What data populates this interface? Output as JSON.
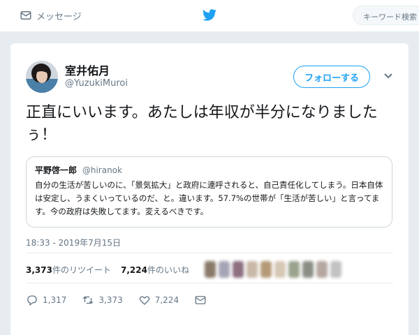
{
  "nav": {
    "messages_label": "メッセージ",
    "search_placeholder": "キーワード検索",
    "brand_color": "#1da1f2"
  },
  "tweet": {
    "author_name": "室井佑月",
    "author_handle": "@YuzukiMuroi",
    "follow_label": "フォローする",
    "text": "正直にいいます。あたしは年収が半分になりましたぅ！",
    "quoted": {
      "author_name": "平野啓一郎",
      "author_handle": "@hiranok",
      "text": "自分の生活が苦しいのに、「景気拡大」と政府に連呼されると、自己責任化してしまう。日本自体は安定し、うまくいっているのだ、と。違います。57.7%の世帯が「生活が苦しい」と言ってます。今の政府は失敗してます。変えるべきです。"
    },
    "timestamp": "18:33 - 2019年7月15日",
    "stats": {
      "retweets_count": "3,373",
      "retweets_label": "件のリツイート",
      "likes_count": "7,224",
      "likes_label": "件のいいね"
    },
    "actions": {
      "reply_count": "1,317",
      "retweet_count": "3,373",
      "like_count": "7,224"
    }
  },
  "colors": {
    "accent": "#1da1f2",
    "secondary_text": "#657786",
    "page_background": "#e6ecf0"
  }
}
